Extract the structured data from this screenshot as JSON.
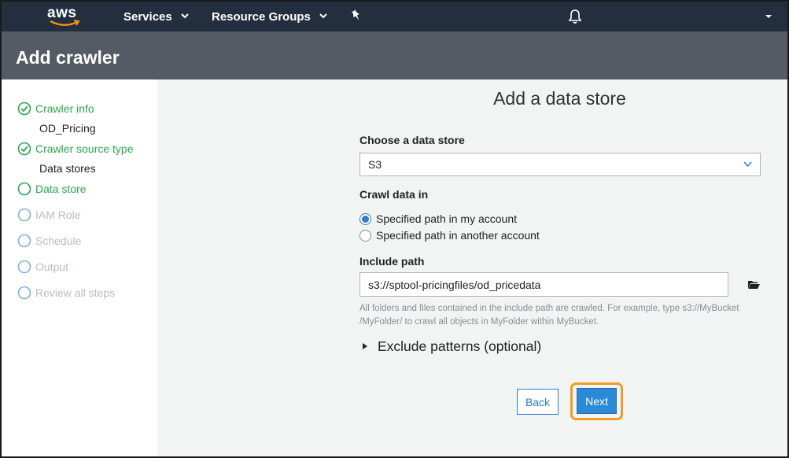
{
  "nav": {
    "logo_text": "aws",
    "services_label": "Services",
    "resource_groups_label": "Resource Groups"
  },
  "page": {
    "title": "Add crawler"
  },
  "sidebar": {
    "steps": [
      {
        "label": "Crawler info",
        "state": "done",
        "sub": "OD_Pricing"
      },
      {
        "label": "Crawler source type",
        "state": "done",
        "sub": "Data stores"
      },
      {
        "label": "Data store",
        "state": "current"
      },
      {
        "label": "IAM Role",
        "state": "todo"
      },
      {
        "label": "Schedule",
        "state": "todo"
      },
      {
        "label": "Output",
        "state": "todo"
      },
      {
        "label": "Review all steps",
        "state": "todo"
      }
    ]
  },
  "main": {
    "title": "Add a data store",
    "data_store_label": "Choose a data store",
    "data_store_value": "S3",
    "crawl_label": "Crawl data in",
    "crawl_options": [
      {
        "label": "Specified path in my account",
        "selected": true
      },
      {
        "label": "Specified path in another account",
        "selected": false
      }
    ],
    "include_path_label": "Include path",
    "include_path_value": "s3://sptool-pricingfiles/od_pricedata",
    "hint_line1": "All folders and files contained in the include path are crawled. For example, type s3://MyBucket",
    "hint_line2": "/MyFolder/ to crawl all objects in MyFolder within MyBucket.",
    "exclude_label": "Exclude patterns (optional)",
    "back_label": "Back",
    "next_label": "Next"
  },
  "colors": {
    "nav_bg": "#232f3e",
    "header_bg": "#545b64",
    "done_green": "#2ea44f",
    "todo_gray": "#b8bcc0",
    "primary_blue": "#2b8ad8",
    "highlight_orange": "#f39c1f"
  }
}
